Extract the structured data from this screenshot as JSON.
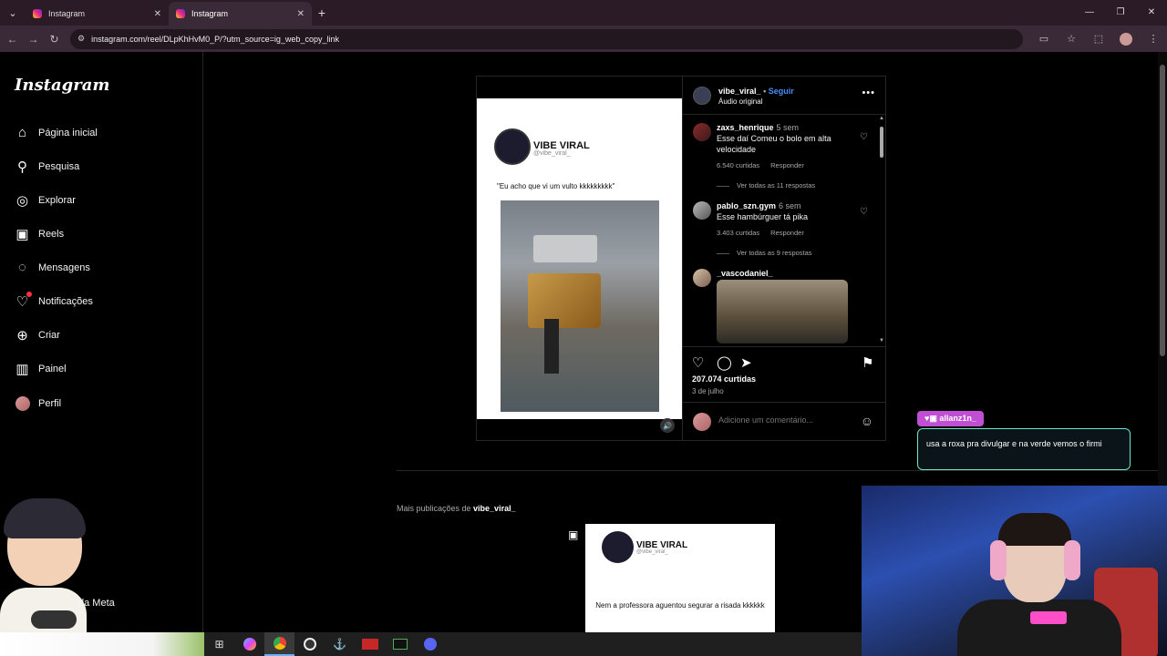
{
  "browser": {
    "tabs": [
      {
        "title": "Instagram",
        "active": false
      },
      {
        "title": "Instagram",
        "active": true
      }
    ],
    "url": "instagram.com/reel/DLpKhHvM0_P/?utm_source=ig_web_copy_link"
  },
  "sidebar": {
    "logo": "Instagram",
    "items": [
      {
        "label": "Página inicial",
        "icon": "home-icon"
      },
      {
        "label": "Pesquisa",
        "icon": "search-icon"
      },
      {
        "label": "Explorar",
        "icon": "compass-icon"
      },
      {
        "label": "Reels",
        "icon": "reels-icon"
      },
      {
        "label": "Mensagens",
        "icon": "messenger-icon"
      },
      {
        "label": "Notificações",
        "icon": "heart-icon"
      },
      {
        "label": "Criar",
        "icon": "plus-icon"
      },
      {
        "label": "Painel",
        "icon": "chart-icon"
      },
      {
        "label": "Perfil",
        "icon": "avatar"
      }
    ],
    "meta_label": "da Meta"
  },
  "post": {
    "author": "vibe_viral_",
    "follow": "Seguir",
    "audio": "Áudio original",
    "media": {
      "brand_title": "VIBE VIRAL",
      "brand_handle": "@vibe_viral_",
      "caption": "\"Eu acho que vi um vulto kkkkkkkkk\""
    },
    "comments": [
      {
        "user": "zaxs_henrique",
        "time": "5 sem",
        "text": "Esse daí Comeu o bolo em alta velocidade",
        "likes": "6.540 curtidas",
        "reply": "Responder",
        "view_replies": "Ver todas as 11 respostas"
      },
      {
        "user": "pablo_szn.gym",
        "time": "6 sem",
        "text": "Esse hambúrguer tá pika",
        "likes": "3.403 curtidas",
        "reply": "Responder",
        "view_replies": "Ver todas as 9 respostas"
      },
      {
        "user": "_vascodaniel_",
        "time": "",
        "text": ""
      }
    ],
    "likes": "207.074 curtidas",
    "date": "3 de julho",
    "comment_placeholder": "Adicione um comentário..."
  },
  "more_posts": {
    "label_prefix": "Mais publicações de ",
    "label_user": "vibe_viral_",
    "thumb_title": "VIBE VIRAL",
    "thumb_handle": "@vibe_viral_",
    "thumb_caption": "Nem a professora aguentou segurar a risada kkkkkk"
  },
  "overlay_chat": {
    "user": "allanz1n_",
    "message": "usa a roxa pra divulgar e na verde vemos o firmi"
  },
  "colors": {
    "follow_blue": "#4a8df8",
    "chat_tag": "#c04fd4",
    "chat_border": "#6ee6c8",
    "notif_red": "#ff3040"
  }
}
